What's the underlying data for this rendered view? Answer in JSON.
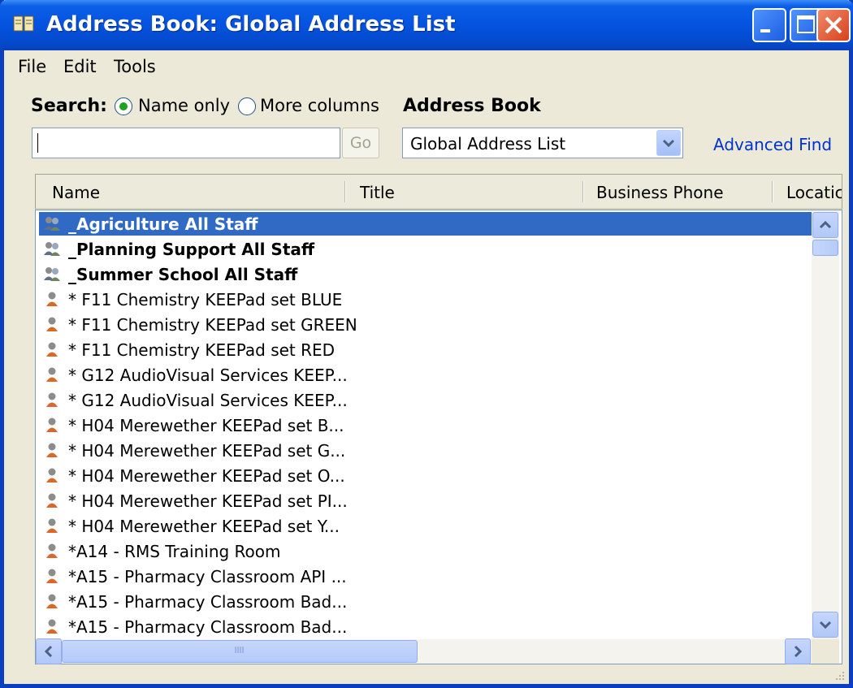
{
  "window": {
    "title": "Address Book: Global Address List"
  },
  "menu": {
    "file": "File",
    "edit": "Edit",
    "tools": "Tools"
  },
  "search": {
    "label": "Search:",
    "option_name_only": "Name only",
    "option_more_columns": "More columns",
    "selected": "Name only",
    "input_value": "",
    "go_label": "Go"
  },
  "address_book": {
    "label": "Address Book",
    "selected": "Global Address List",
    "advanced_find": "Advanced Find"
  },
  "columns": [
    "Name",
    "Title",
    "Business Phone",
    "Locatic"
  ],
  "rows": [
    {
      "name": "_Agriculture All Staff",
      "type": "group",
      "selected": true
    },
    {
      "name": "_Planning Support All Staff",
      "type": "group"
    },
    {
      "name": "_Summer School All Staff",
      "type": "group"
    },
    {
      "name": "* F11 Chemistry KEEPad set BLUE",
      "type": "user"
    },
    {
      "name": "* F11 Chemistry KEEPad set GREEN",
      "type": "user"
    },
    {
      "name": "* F11 Chemistry KEEPad set RED",
      "type": "user"
    },
    {
      "name": "* G12 AudioVisual Services KEEP...",
      "type": "user"
    },
    {
      "name": "* G12 AudioVisual Services KEEP...",
      "type": "user"
    },
    {
      "name": "* H04 Merewether KEEPad set B...",
      "type": "user"
    },
    {
      "name": "* H04 Merewether KEEPad set G...",
      "type": "user"
    },
    {
      "name": "* H04 Merewether KEEPad set O...",
      "type": "user"
    },
    {
      "name": "* H04 Merewether KEEPad set PI...",
      "type": "user"
    },
    {
      "name": "* H04 Merewether KEEPad set Y...",
      "type": "user"
    },
    {
      "name": "*A14 - RMS Training Room",
      "type": "user"
    },
    {
      "name": "*A15 - Pharmacy Classroom API ...",
      "type": "user"
    },
    {
      "name": "*A15 - Pharmacy Classroom Bad...",
      "type": "user"
    },
    {
      "name": "*A15 - Pharmacy Classroom Bad...",
      "type": "user"
    }
  ],
  "icons": {
    "title": "address-book-icon",
    "group": "group-icon",
    "user": "user-icon",
    "minimize": "minimize-icon",
    "maximize": "maximize-icon",
    "close": "close-icon",
    "dropdown": "chevron-down-icon",
    "scroll_up": "arrow-up-icon",
    "scroll_down": "arrow-down-icon",
    "scroll_left": "arrow-left-icon",
    "scroll_right": "arrow-right-icon",
    "grip": "resize-grip-icon"
  },
  "colors": {
    "titlebar": "#0553e0",
    "selection": "#316ac5",
    "link": "#0033cc",
    "face": "#ece9d8"
  }
}
